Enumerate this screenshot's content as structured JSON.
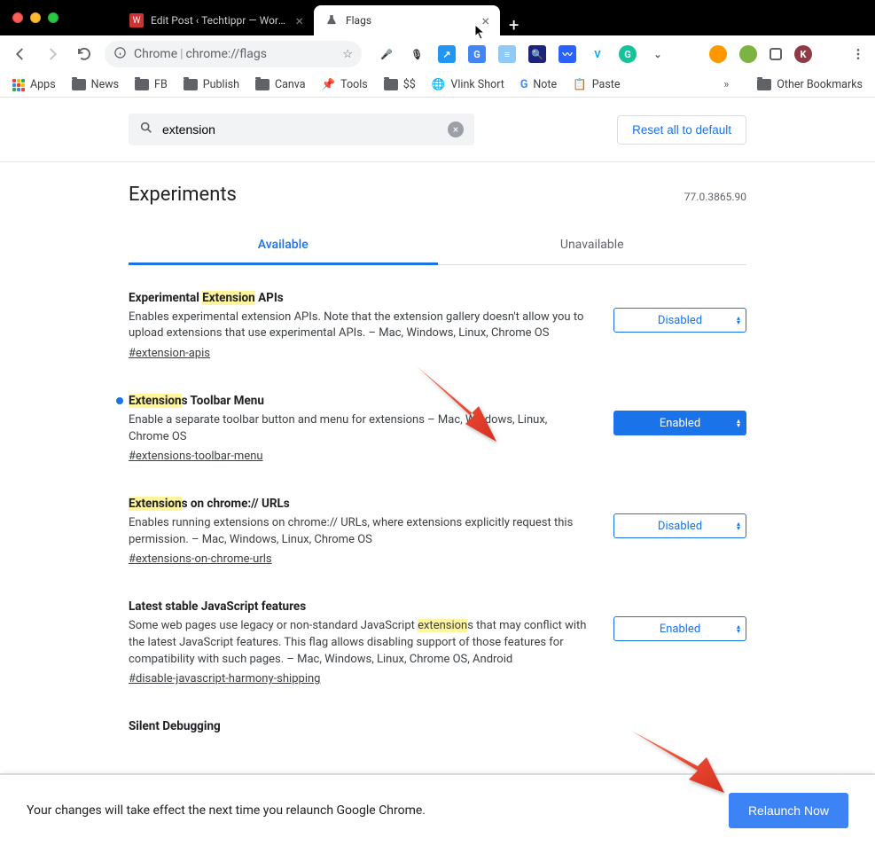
{
  "window": {
    "tabs": [
      {
        "title": "Edit Post ‹ Techtippr — WordP",
        "active": false
      },
      {
        "title": "Flags",
        "active": true
      }
    ]
  },
  "omnibox": {
    "prefix": "Chrome",
    "path": "chrome://flags"
  },
  "bookmarks": {
    "apps": "Apps",
    "items": [
      "News",
      "FB",
      "Publish",
      "Canva",
      "Tools",
      "$$",
      "Vlink Short",
      "Note",
      "Paste"
    ],
    "other": "Other Bookmarks"
  },
  "search": {
    "value": "extension"
  },
  "reset_label": "Reset all to default",
  "page": {
    "title": "Experiments",
    "version": "77.0.3865.90"
  },
  "flag_tabs": {
    "available": "Available",
    "unavailable": "Unavailable"
  },
  "select_labels": {
    "disabled": "Disabled",
    "enabled": "Enabled"
  },
  "flags": [
    {
      "title_pre": "Experimental ",
      "title_hl": "Extension",
      "title_post": " APIs",
      "desc": "Enables experimental extension APIs. Note that the extension gallery doesn't allow you to upload extensions that use experimental APIs. – Mac, Windows, Linux, Chrome OS",
      "link": "#extension-apis",
      "state": "Disabled",
      "active": false,
      "dot": false
    },
    {
      "title_pre": "",
      "title_hl": "Extension",
      "title_post": "s Toolbar Menu",
      "desc": "Enable a separate toolbar button and menu for extensions – Mac, Windows, Linux, Chrome OS",
      "link": "#extensions-toolbar-menu",
      "state": "Enabled",
      "active": true,
      "dot": true
    },
    {
      "title_pre": "",
      "title_hl": "Extension",
      "title_post": "s on chrome:// URLs",
      "desc": "Enables running extensions on chrome:// URLs, where extensions explicitly request this permission. – Mac, Windows, Linux, Chrome OS",
      "link": "#extensions-on-chrome-urls",
      "state": "Disabled",
      "active": false,
      "dot": false
    },
    {
      "title_plain": "Latest stable JavaScript features",
      "desc_pre": "Some web pages use legacy or non-standard JavaScript ",
      "desc_hl": "extension",
      "desc_post": "s that may conflict with the latest JavaScript features. This flag allows disabling support of those features for compatibility with such pages. – Mac, Windows, Linux, Chrome OS, Android",
      "link": "#disable-javascript-harmony-shipping",
      "state": "Enabled",
      "active": false,
      "dot": false
    },
    {
      "title_plain": "Silent Debugging"
    }
  ],
  "bottom": {
    "message": "Your changes will take effect the next time you relaunch Google Chrome.",
    "relaunch": "Relaunch Now"
  }
}
